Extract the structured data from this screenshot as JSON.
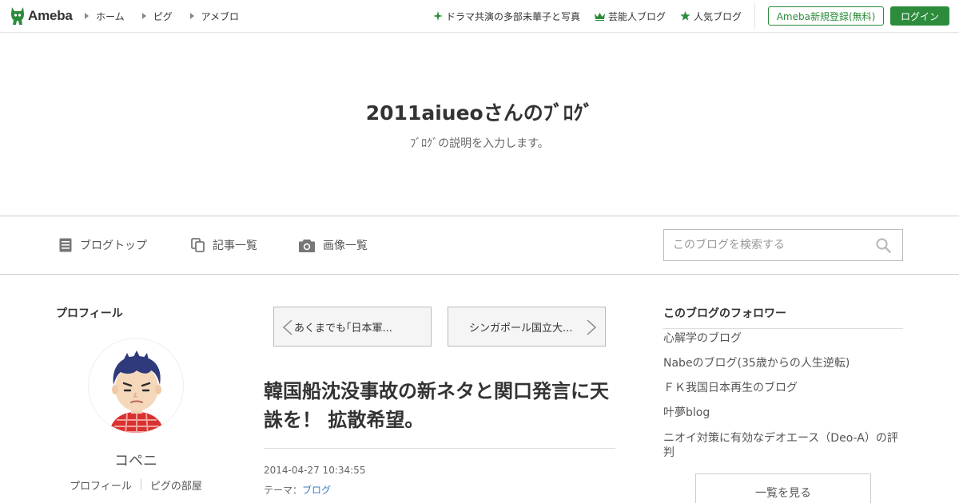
{
  "topbar": {
    "logo_text": "Ameba",
    "nav": [
      {
        "label": "ホーム"
      },
      {
        "label": "ピグ"
      },
      {
        "label": "アメブロ"
      }
    ],
    "links": [
      {
        "label": "ドラマ共演の多部未華子と写真",
        "icon": "sparkle-icon"
      },
      {
        "label": "芸能人ブログ",
        "icon": "crown-icon"
      },
      {
        "label": "人気ブログ",
        "icon": "star-icon"
      }
    ],
    "register_label": "Ameba新規登録(無料)",
    "login_label": "ログイン"
  },
  "header": {
    "title": "2011aiueoさんのﾌﾞﾛｸﾞ",
    "description": "ﾌﾞﾛｸﾞの説明を入力します。"
  },
  "navbar": {
    "items": [
      {
        "label": "ブログトップ",
        "icon": "document-icon"
      },
      {
        "label": "記事一覧",
        "icon": "copy-icon"
      },
      {
        "label": "画像一覧",
        "icon": "camera-icon"
      }
    ],
    "search_placeholder": "このブログを検索する"
  },
  "profile": {
    "heading": "プロフィール",
    "nickname": "コペニ",
    "links": [
      "プロフィール",
      "ピグの部屋"
    ]
  },
  "entry": {
    "prev_label": "あくまでも｢日本軍...",
    "next_label": "シンガポール国立大...",
    "title": "韓国船沈没事故の新ネタと関口発言に天誅を！ 拡散希望。",
    "date": "2014-04-27 10:34:55",
    "theme_label": "テーマ：",
    "theme_value": "ブログ"
  },
  "followers": {
    "heading": "このブログのフォロワー",
    "items": [
      "心解学のブログ",
      "Nabeのブログ(35歳からの人生逆転)",
      "ＦＫ我国日本再生のブログ",
      "叶夢blog",
      "ニオイ対策に有効なデオエース（Deo-A）の評判"
    ],
    "view_all_label": "一覧を見る"
  },
  "colors": {
    "brand_green": "#2d8c3c",
    "link_blue": "#3a7bc8"
  }
}
